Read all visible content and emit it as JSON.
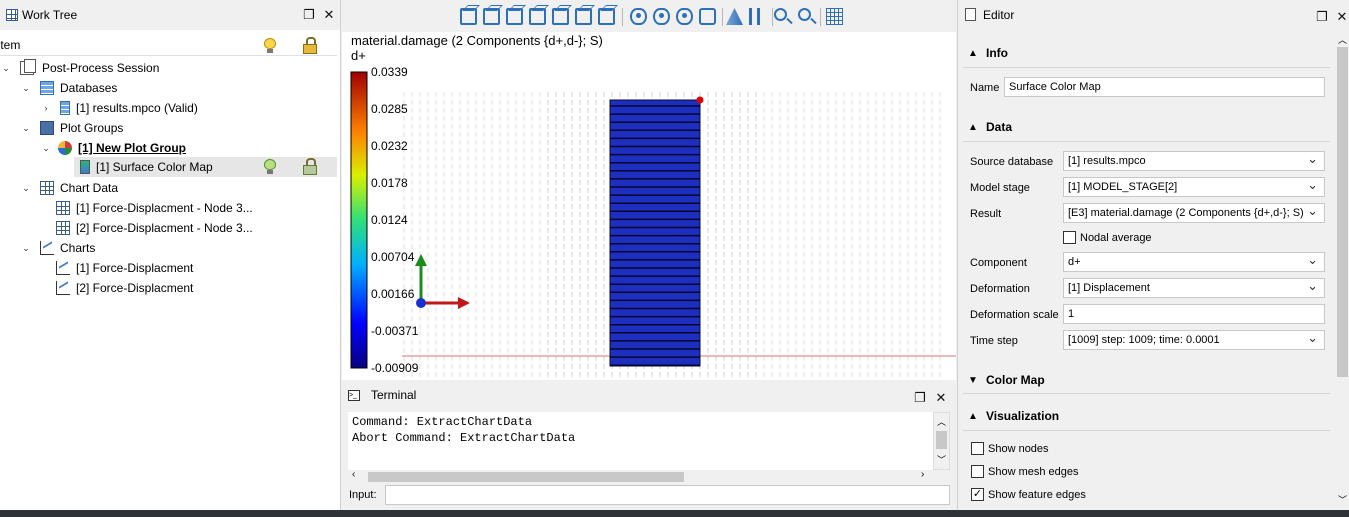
{
  "worktree": {
    "title": "Work Tree",
    "column_header": "Item",
    "items": [
      {
        "label": "Post-Process Session"
      },
      {
        "label": "Databases"
      },
      {
        "label": "[1] results.mpco (Valid)"
      },
      {
        "label": "Plot Groups"
      },
      {
        "label": "[1] New Plot Group"
      },
      {
        "label": "[1] Surface Color Map"
      },
      {
        "label": "Chart Data"
      },
      {
        "label": "[1] Force-Displacment - Node 3..."
      },
      {
        "label": "[2] Force-Displacment - Node 3..."
      },
      {
        "label": "Charts"
      },
      {
        "label": "[1] Force-Displacment"
      },
      {
        "label": "[2] Force-Displacment"
      }
    ]
  },
  "viewport": {
    "title_line1": "material.damage (2 Components {d+,d-}; S)",
    "title_line2": "d+",
    "colorbar_ticks": [
      "0.0339",
      "0.0285",
      "0.0232",
      "0.0178",
      "0.0124",
      "0.00704",
      "0.00166",
      "-0.00371",
      "-0.00909"
    ]
  },
  "terminal": {
    "title": "Terminal",
    "lines": "Command: ExtractChartData\nAbort Command: ExtractChartData",
    "input_label": "Input:",
    "input_value": ""
  },
  "editor": {
    "title": "Editor",
    "sections": {
      "info": "Info",
      "data": "Data",
      "colormap": "Color Map",
      "visualization": "Visualization"
    },
    "fields": {
      "name_label": "Name",
      "name_value": "Surface Color Map",
      "source_label": "Source database",
      "source_value": "[1] results.mpco",
      "stage_label": "Model stage",
      "stage_value": "[1] MODEL_STAGE[2]",
      "result_label": "Result",
      "result_value": "[E3] material.damage (2 Components {d+,d-}; S)",
      "nodal_label": "Nodal average",
      "component_label": "Component",
      "component_value": "d+",
      "deformation_label": "Deformation",
      "deformation_value": "[1] Displacement",
      "defscale_label": "Deformation scale",
      "defscale_value": "1",
      "timestep_label": "Time step",
      "timestep_value": "[1009] step: 1009; time: 0.0001"
    },
    "visual": {
      "show_nodes": "Show nodes",
      "show_mesh_edges": "Show mesh edges",
      "show_feature_edges": "Show feature edges",
      "show_feature_edges_checked": true
    }
  },
  "colors": {
    "accent": "#2d6fb8",
    "mesh_fill": "#1c2fbf",
    "selection": "#e6e6e6"
  }
}
